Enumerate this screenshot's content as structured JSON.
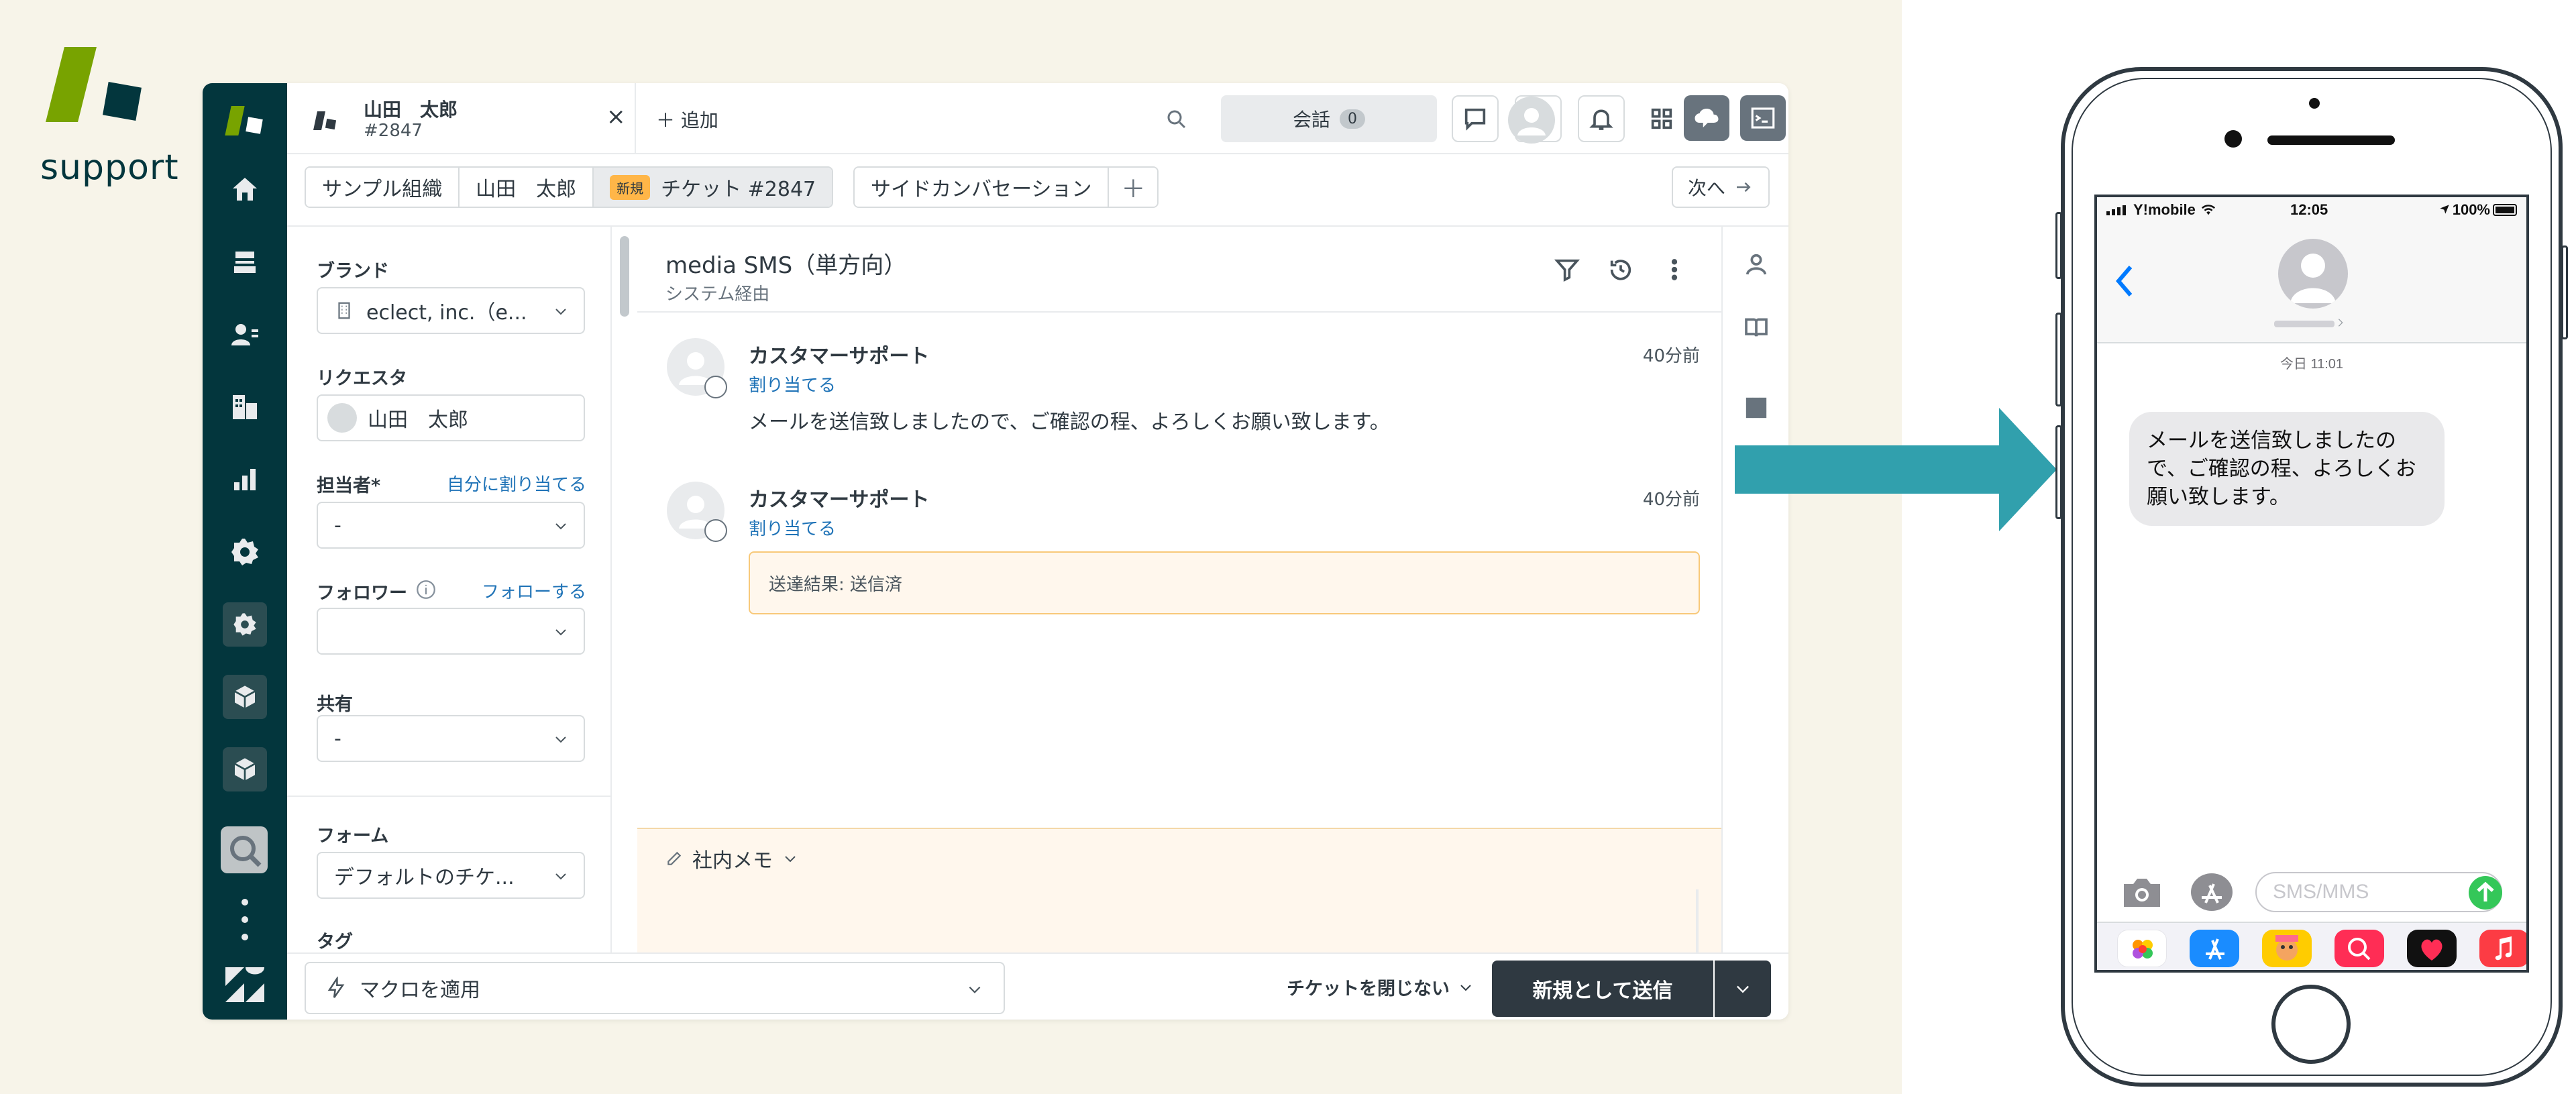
{
  "brand": {
    "word": "support"
  },
  "topbar": {
    "ticket_tab_name": "山田　太郎",
    "ticket_tab_number": "#2847",
    "close_glyph": "×",
    "add_label": "＋ 追加",
    "conversation_label": "会話",
    "conversation_count": "0"
  },
  "breadcrumbs": {
    "items": [
      "サンプル組織",
      "山田　太郎"
    ],
    "status_badge": "新規",
    "ticket_label": "チケット #2847",
    "side_conversation": "サイドカンバセーション",
    "plus": "＋",
    "next_label": "次へ"
  },
  "fields": {
    "brand_label": "ブランド",
    "brand_value": "eclect, inc.（e...",
    "requester_label": "リクエスタ",
    "requester_value": "山田　太郎",
    "assignee_label": "担当者*",
    "assignee_link": "自分に割り当てる",
    "assignee_value": "-",
    "followers_label": "フォロワー",
    "followers_link": "フォローする",
    "followers_value": "",
    "share_label": "共有",
    "share_value": "-",
    "form_label": "フォーム",
    "form_value": "デフォルトのチケ...",
    "tags_label": "タグ"
  },
  "conversation": {
    "title": "media SMS（単方向）",
    "subtitle": "システム経由",
    "messages": [
      {
        "author": "カスタマーサポート",
        "time": "40分前",
        "assign": "割り当てる",
        "body": "メールを送信致しましたので、ご確認の程、よろしくお願い致します。"
      },
      {
        "author": "カスタマーサポート",
        "time": "40分前",
        "assign": "割り当てる",
        "notice": "送達結果: 送信済"
      }
    ],
    "composer_mode": "社内メモ"
  },
  "bottombar": {
    "macro_label": "マクロを適用",
    "close_option": "チケットを閉じない",
    "submit_prefix": "新規",
    "submit_suffix": "として送信"
  },
  "phone": {
    "carrier": "Y!mobile",
    "time": "12:05",
    "battery": "100%",
    "date_label": "今日 11:01",
    "message": "メールを送信致しましたので、ご確認の程、よろしくお願い致します。",
    "input_placeholder": "SMS/MMS"
  },
  "colors": {
    "rail": "#03363d",
    "brand_green": "#78a300",
    "link_blue": "#1f73b7",
    "arrow_teal": "#31a0ad",
    "submit_dark": "#2f3941",
    "ios_blue": "#007aff",
    "ios_green": "#34c759"
  },
  "icons": {
    "rail": [
      "home-icon",
      "views-icon",
      "customers-icon",
      "organizations-icon",
      "reporting-icon",
      "admin-gear-icon",
      "app-gear-icon",
      "app-box-icon",
      "app-box-icon",
      "more-dots-icon",
      "zendesk-icon"
    ],
    "topbar": [
      "search-icon",
      "chat-icon",
      "phone-icon",
      "bell-icon",
      "apps-grid-icon",
      "avatar-icon",
      "cloud-chat-icon",
      "terminal-icon",
      "profile-icon"
    ]
  }
}
